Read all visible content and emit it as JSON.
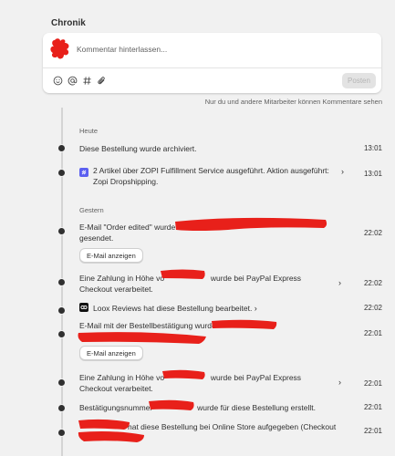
{
  "timeline": {
    "title": "Chronik",
    "comment_placeholder": "Kommentar hinterlassen...",
    "post_label": "Posten",
    "visibility_note": "Nur du und andere Mitarbeiter können Kommentare sehen",
    "toolbar_icons": [
      "emoji-icon",
      "mention-icon",
      "hashtag-icon",
      "attachment-icon"
    ]
  },
  "groups": [
    {
      "date": "Heute",
      "events": [
        {
          "text": "Diese Bestellung wurde archiviert.",
          "time": "13:01"
        },
        {
          "text": "2 Artikel über ZOPI Fulfillment Service ausgeführt. Aktion ausgeführt: Zopi Dropshipping.",
          "time": "13:01"
        }
      ]
    },
    {
      "date": "Gestern",
      "events": [
        {
          "text_before": "E-Mail \"Order edited\" wurde an",
          "text_after": "gesendet.",
          "time": "22:02",
          "button": "E-Mail anzeigen"
        },
        {
          "text_before": "Eine Zahlung in Höhe vo",
          "text_after": "wurde bei PayPal Express Checkout verarbeitet.",
          "time": "22:02"
        },
        {
          "text": "Loox Reviews hat diese Bestellung bearbeitet.",
          "time": "22:02"
        },
        {
          "text_before": "E-Mail mit der Bestellbestätigung wurde",
          "time": "22:01",
          "button": "E-Mail anzeigen"
        },
        {
          "text_before": "Eine Zahlung in Höhe vo",
          "text_after": "wurde bei PayPal Express Checkout verarbeitet.",
          "time": "22:01"
        },
        {
          "text_before": "Bestätigungsnummer",
          "text_after": "wurde für diese Bestellung erstellt.",
          "time": "22:01"
        },
        {
          "text_after": "hat diese Bestellung bei Online Store aufgegeben (Checkout",
          "time": "22:01"
        }
      ]
    }
  ],
  "colors": {
    "background": "#f1f1f1",
    "card": "#ffffff",
    "text": "#303030",
    "muted": "#616161",
    "redaction": "#e8201a",
    "zopi_icon": "#5b5ff0",
    "loox_icon": "#111111"
  }
}
